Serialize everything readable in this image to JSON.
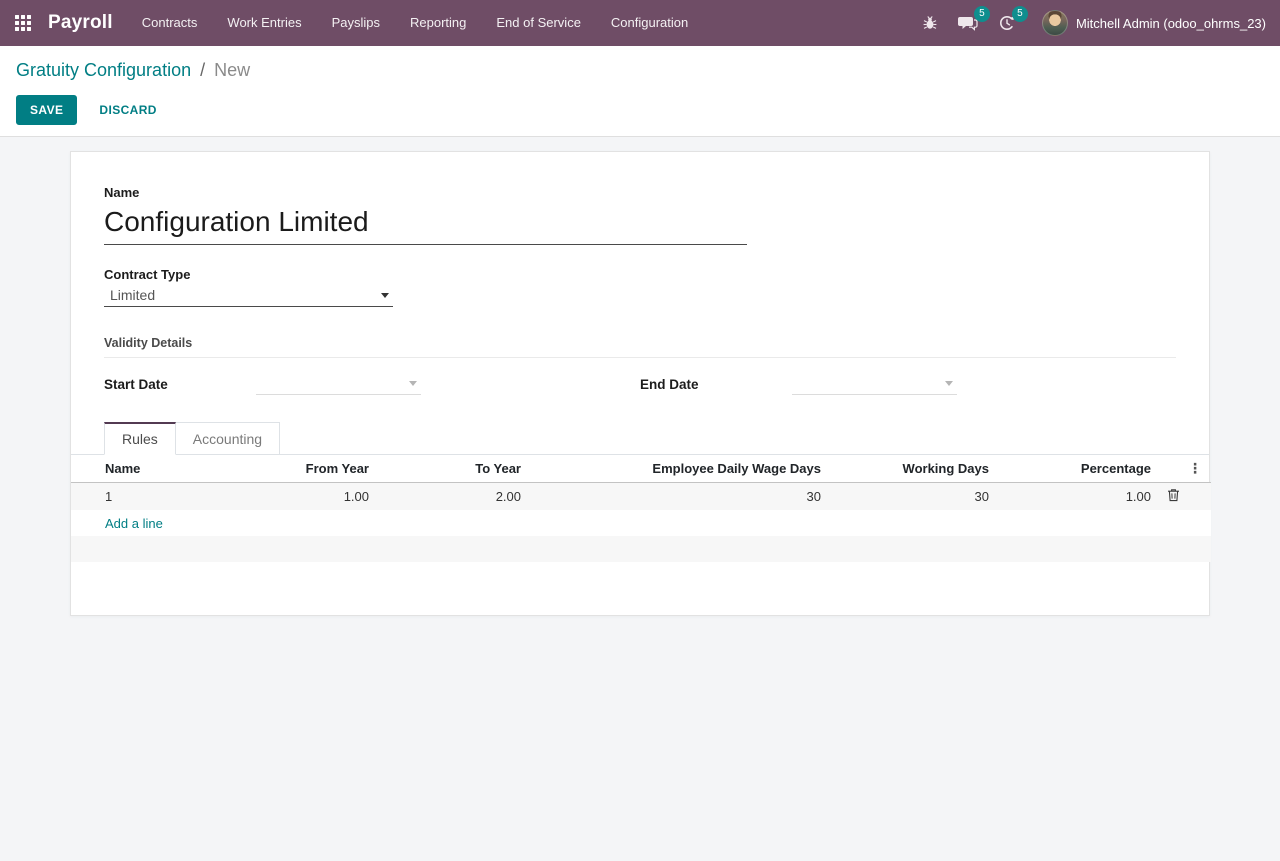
{
  "nav": {
    "app_name": "Payroll",
    "menu_items": [
      "Contracts",
      "Work Entries",
      "Payslips",
      "Reporting",
      "End of Service",
      "Configuration"
    ],
    "messages_badge": "5",
    "activities_badge": "5",
    "user_name": "Mitchell Admin (odoo_ohrms_23)"
  },
  "breadcrumb": {
    "parent": "Gratuity Configuration",
    "separator": "/",
    "current": "New"
  },
  "actions": {
    "save_label": "SAVE",
    "discard_label": "DISCARD"
  },
  "form": {
    "name_label": "Name",
    "name_value": "Configuration Limited",
    "contract_type_label": "Contract Type",
    "contract_type_value": "Limited",
    "validity_section_title": "Validity Details",
    "start_date_label": "Start Date",
    "start_date_value": "",
    "end_date_label": "End Date",
    "end_date_value": ""
  },
  "tabs": [
    {
      "label": "Rules",
      "active": true
    },
    {
      "label": "Accounting",
      "active": false
    }
  ],
  "rules_table": {
    "columns": [
      "Name",
      "From Year",
      "To Year",
      "Employee Daily Wage Days",
      "Working Days",
      "Percentage"
    ],
    "rows": [
      {
        "name": "1",
        "from_year": "1.00",
        "to_year": "2.00",
        "employee_daily_wage_days": "30",
        "working_days": "30",
        "percentage": "1.00"
      }
    ],
    "add_line_label": "Add a line"
  },
  "icons": {
    "apps_grid": "grid-3x3",
    "bug": "bug",
    "messages": "speech-bubbles",
    "activities": "clock",
    "delete_row": "trash",
    "column_options": "kebab-vertical",
    "dropdown_caret": "caret-down"
  },
  "colors": {
    "nav_bg": "#6f4d66",
    "accent_teal": "#017e84",
    "badge_teal": "#0f8e8e",
    "tab_active_top": "#533a52"
  }
}
